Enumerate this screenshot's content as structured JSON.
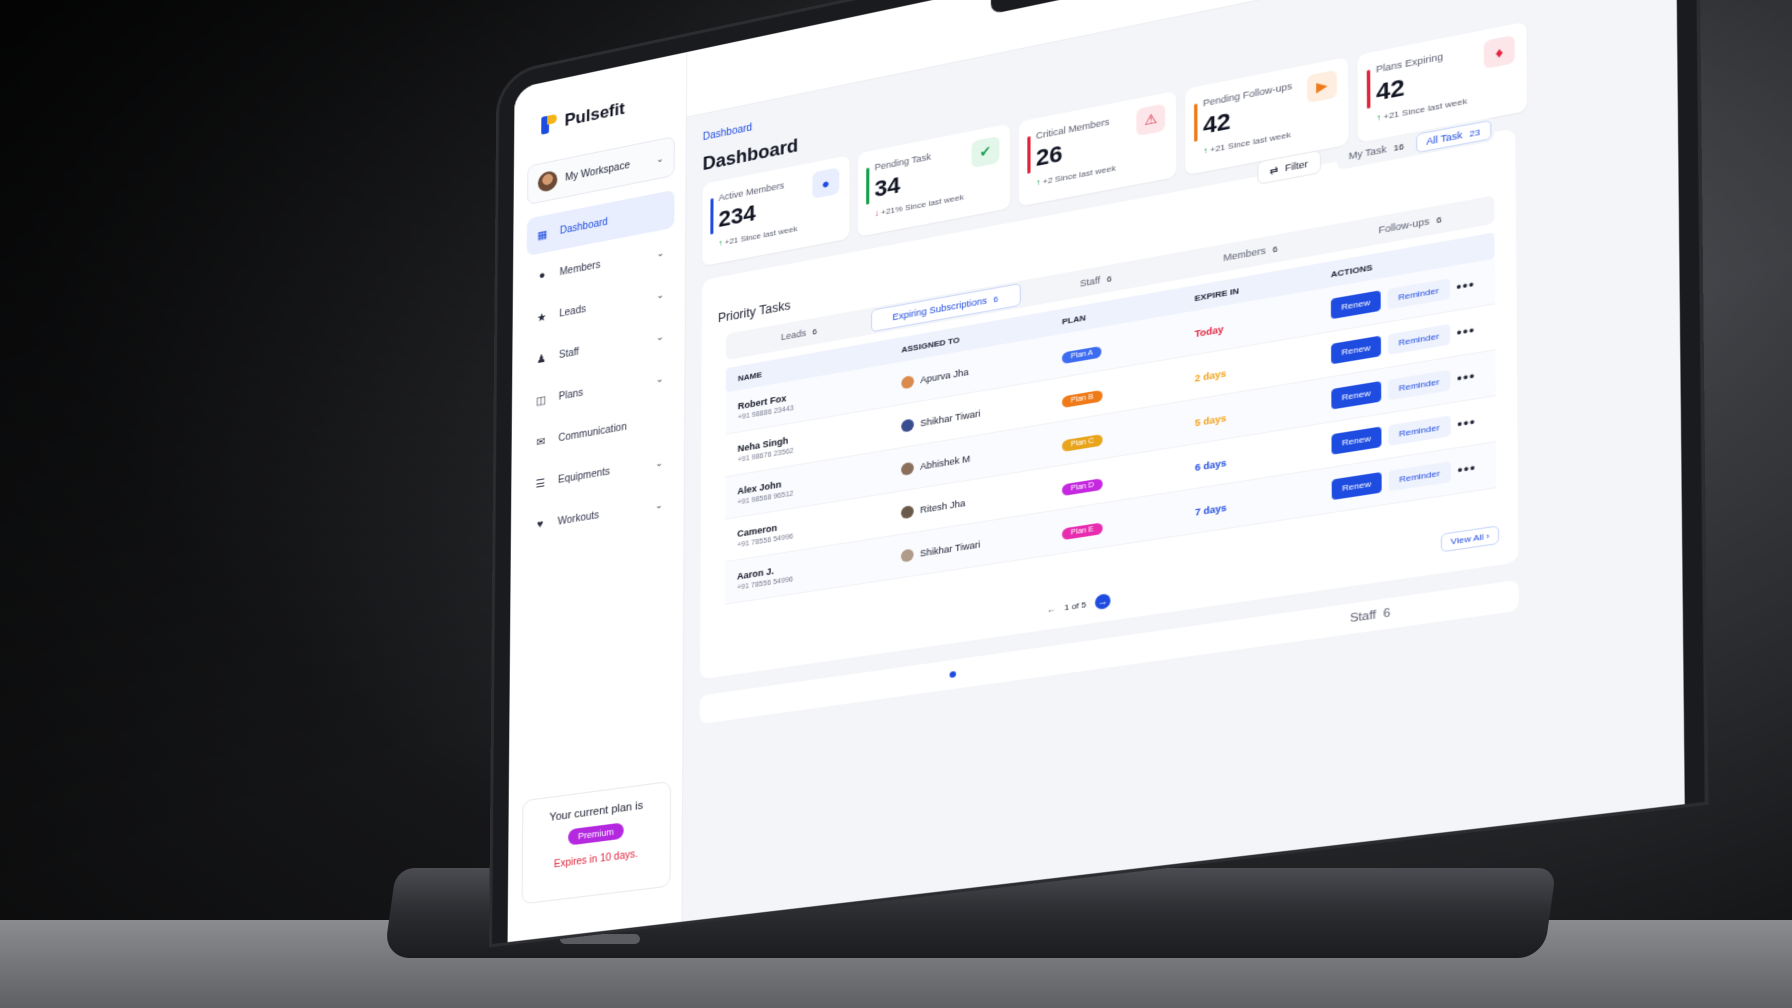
{
  "app": {
    "name": "Pulsefit"
  },
  "workspace": {
    "label": "My Workspace"
  },
  "sidebar": {
    "items": [
      {
        "label": "Dashboard",
        "icon": "grid-icon",
        "active": true,
        "expandable": false
      },
      {
        "label": "Members",
        "icon": "members-icon",
        "active": false,
        "expandable": true
      },
      {
        "label": "Leads",
        "icon": "leads-icon",
        "active": false,
        "expandable": true
      },
      {
        "label": "Staff",
        "icon": "staff-icon",
        "active": false,
        "expandable": true
      },
      {
        "label": "Plans",
        "icon": "plans-icon",
        "active": false,
        "expandable": true
      },
      {
        "label": "Communication",
        "icon": "mail-icon",
        "active": false,
        "expandable": false
      },
      {
        "label": "Equipments",
        "icon": "dumbbell-icon",
        "active": false,
        "expandable": true
      },
      {
        "label": "Workouts",
        "icon": "heart-icon",
        "active": false,
        "expandable": true
      }
    ]
  },
  "plan_card": {
    "title": "Your current plan is",
    "badge": "Premium",
    "expires": "Expires in 10 days."
  },
  "header": {
    "breadcrumb": "Dashboard",
    "title": "Dashboard"
  },
  "stats": [
    {
      "label": "Active Members",
      "value": "234",
      "delta": "+21",
      "since": "Since last week",
      "trend": "up",
      "color": "#1f4ce0",
      "icon": "members-icon",
      "icon_bg": "#e8eefe"
    },
    {
      "label": "Pending Task",
      "value": "34",
      "delta": "+21%",
      "since": "Since last week",
      "trend": "down",
      "color": "#18a04c",
      "icon": "user-check-icon",
      "icon_bg": "#e3f6ea"
    },
    {
      "label": "Critical Members",
      "value": "26",
      "delta": "+2",
      "since": "Since last week",
      "trend": "up",
      "color": "#e0243c",
      "icon": "user-alert-icon",
      "icon_bg": "#fde6ea"
    },
    {
      "label": "Pending Follow-ups",
      "value": "42",
      "delta": "+21",
      "since": "Since last week",
      "trend": "up",
      "color": "#f07a18",
      "icon": "video-icon",
      "icon_bg": "#fdeedf"
    },
    {
      "label": "Plans Expiring",
      "value": "42",
      "delta": "+21",
      "since": "Since last week",
      "trend": "up",
      "color": "#e0243c",
      "icon": "tag-icon",
      "icon_bg": "#fde6ea"
    }
  ],
  "controls": {
    "filter_label": "Filter",
    "my_task_label": "My Task",
    "my_task_count": "16",
    "all_task_label": "All Task",
    "all_task_count": "23"
  },
  "priority": {
    "title": "Priority Tasks",
    "tabs": [
      {
        "label": "Leads",
        "count": "6",
        "active": false
      },
      {
        "label": "Expiring Subscriptions",
        "count": "6",
        "active": true
      },
      {
        "label": "Staff",
        "count": "6",
        "active": false
      },
      {
        "label": "Members",
        "count": "6",
        "active": false
      },
      {
        "label": "Follow-ups",
        "count": "6",
        "active": false
      }
    ],
    "columns": {
      "name": "NAME",
      "assigned": "ASSIGNED TO",
      "plan": "PLAN",
      "expire": "EXPIRE IN",
      "actions": "ACTIONS"
    },
    "rows": [
      {
        "name": "Robert Fox",
        "phone": "+91 98886 23443",
        "assigned": "Apurva Jha",
        "plan": "Plan A",
        "plan_color": "#3d6cf0",
        "expire": "Today",
        "expire_color": "#e0243c"
      },
      {
        "name": "Neha Singh",
        "phone": "+91 98676 23562",
        "assigned": "Shikhar Tiwari",
        "plan": "Plan B",
        "plan_color": "#f07a18",
        "expire": "2 days",
        "expire_color": "#f2a218"
      },
      {
        "name": "Alex John",
        "phone": "+91 98568 96512",
        "assigned": "Abhishek M",
        "plan": "Plan C",
        "plan_color": "#e8a41a",
        "expire": "5 days",
        "expire_color": "#f2a218"
      },
      {
        "name": "Cameron",
        "phone": "+91 78556 54996",
        "assigned": "Ritesh Jha",
        "plan": "Plan D",
        "plan_color": "#c528e0",
        "expire": "6 days",
        "expire_color": "#1f4ce0"
      },
      {
        "name": "Aaron J.",
        "phone": "+91 78556 54996",
        "assigned": "Shikhar Tiwari",
        "plan": "Plan E",
        "plan_color": "#e82cb0",
        "expire": "7 days",
        "expire_color": "#1f4ce0"
      }
    ],
    "renew_label": "Renew",
    "reminder_label": "Reminder",
    "pager": "1 of 5",
    "view_all": "View All"
  },
  "bottom_tabs": [
    {
      "label": "Staff",
      "count": "6"
    }
  ],
  "colors": {
    "accent": "#1f4ce0",
    "brand_yellow": "#f2b417"
  }
}
